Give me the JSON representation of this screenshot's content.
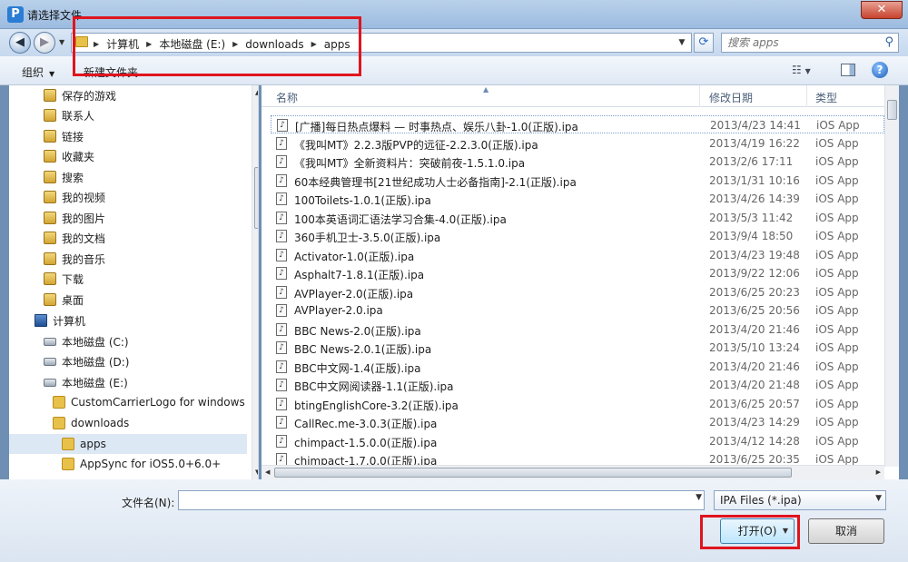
{
  "window": {
    "icon_letter": "P",
    "title": "请选择文件",
    "close_label": "✕"
  },
  "nav": {
    "back_icon": "back-arrow-icon",
    "forward_icon": "forward-arrow-icon",
    "breadcrumbs": [
      "计算机",
      "本地磁盘 (E:)",
      "downloads",
      "apps"
    ],
    "search_placeholder": "搜索 apps"
  },
  "toolbar": {
    "organize_label": "组织",
    "new_folder_label": "新建文件夹"
  },
  "sidebar": {
    "items": [
      {
        "label": "保存的游戏",
        "icon": "special-folder-icon"
      },
      {
        "label": "联系人",
        "icon": "special-folder-icon"
      },
      {
        "label": "链接",
        "icon": "special-folder-icon"
      },
      {
        "label": "收藏夹",
        "icon": "special-folder-icon"
      },
      {
        "label": "搜索",
        "icon": "special-folder-icon"
      },
      {
        "label": "我的视频",
        "icon": "special-folder-icon"
      },
      {
        "label": "我的图片",
        "icon": "special-folder-icon"
      },
      {
        "label": "我的文档",
        "icon": "special-folder-icon"
      },
      {
        "label": "我的音乐",
        "icon": "special-folder-icon"
      },
      {
        "label": "下载",
        "icon": "special-folder-icon"
      },
      {
        "label": "桌面",
        "icon": "special-folder-icon"
      },
      {
        "label": "计算机",
        "icon": "computer-icon"
      },
      {
        "label": "本地磁盘 (C:)",
        "icon": "drive-icon"
      },
      {
        "label": "本地磁盘 (D:)",
        "icon": "drive-icon"
      },
      {
        "label": "本地磁盘 (E:)",
        "icon": "drive-icon"
      },
      {
        "label": "CustomCarrierLogo for windows",
        "icon": "folder-icon"
      },
      {
        "label": "downloads",
        "icon": "folder-icon"
      },
      {
        "label": "apps",
        "icon": "folder-icon",
        "selected": true
      },
      {
        "label": "AppSync for iOS5.0+6.0+",
        "icon": "folder-icon"
      }
    ]
  },
  "filelist": {
    "columns": {
      "name": "名称",
      "date": "修改日期",
      "type": "类型"
    },
    "rows": [
      {
        "name": "[广播]每日热点爆料 — 时事热点、娱乐八卦-1.0(正版).ipa",
        "date": "2013/4/23 14:41",
        "type": "iOS App"
      },
      {
        "name": "《我叫MT》2.2.3版PVP的远征-2.2.3.0(正版).ipa",
        "date": "2013/4/19 16:22",
        "type": "iOS App"
      },
      {
        "name": "《我叫MT》全新资料片：突破前夜-1.5.1.0.ipa",
        "date": "2013/2/6 17:11",
        "type": "iOS App"
      },
      {
        "name": "60本经典管理书[21世纪成功人士必备指南]-2.1(正版).ipa",
        "date": "2013/1/31 10:16",
        "type": "iOS App"
      },
      {
        "name": "100Toilets-1.0.1(正版).ipa",
        "date": "2013/4/26 14:39",
        "type": "iOS App"
      },
      {
        "name": "100本英语词汇语法学习合集-4.0(正版).ipa",
        "date": "2013/5/3 11:42",
        "type": "iOS App"
      },
      {
        "name": "360手机卫士-3.5.0(正版).ipa",
        "date": "2013/9/4 18:50",
        "type": "iOS App"
      },
      {
        "name": "Activator-1.0(正版).ipa",
        "date": "2013/4/23 19:48",
        "type": "iOS App"
      },
      {
        "name": "Asphalt7-1.8.1(正版).ipa",
        "date": "2013/9/22 12:06",
        "type": "iOS App"
      },
      {
        "name": "AVPlayer-2.0(正版).ipa",
        "date": "2013/6/25 20:23",
        "type": "iOS App"
      },
      {
        "name": "AVPlayer-2.0.ipa",
        "date": "2013/6/25 20:56",
        "type": "iOS App"
      },
      {
        "name": "BBC News-2.0(正版).ipa",
        "date": "2013/4/20 21:46",
        "type": "iOS App"
      },
      {
        "name": "BBC News-2.0.1(正版).ipa",
        "date": "2013/5/10 13:24",
        "type": "iOS App"
      },
      {
        "name": "BBC中文网-1.4(正版).ipa",
        "date": "2013/4/20 21:46",
        "type": "iOS App"
      },
      {
        "name": "BBC中文网阅读器-1.1(正版).ipa",
        "date": "2013/4/20 21:48",
        "type": "iOS App"
      },
      {
        "name": "btingEnglishCore-3.2(正版).ipa",
        "date": "2013/6/25 20:57",
        "type": "iOS App"
      },
      {
        "name": "CallRec.me-3.0.3(正版).ipa",
        "date": "2013/4/23 14:29",
        "type": "iOS App"
      },
      {
        "name": "chimpact-1.5.0.0(正版).ipa",
        "date": "2013/4/12 14:28",
        "type": "iOS App"
      },
      {
        "name": "chimpact-1.7.0.0(正版).ipa",
        "date": "2013/6/25 20:35",
        "type": "iOS App"
      }
    ]
  },
  "footer": {
    "filename_label": "文件名(N):",
    "filename_value": "",
    "filter_value": "IPA Files (*.ipa)",
    "open_label": "打开(O)",
    "cancel_label": "取消"
  }
}
